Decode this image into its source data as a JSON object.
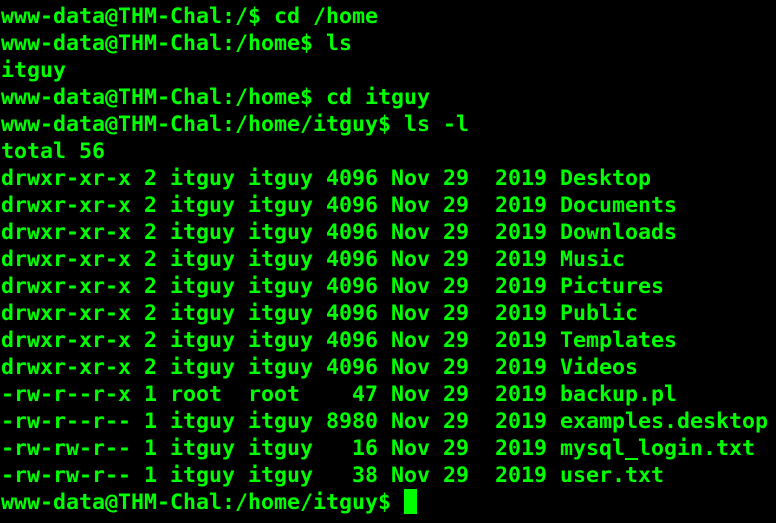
{
  "terminal": {
    "lines": [
      "www-data@THM-Chal:/$ cd /home",
      "www-data@THM-Chal:/home$ ls",
      "itguy",
      "www-data@THM-Chal:/home$ cd itguy",
      "www-data@THM-Chal:/home/itguy$ ls -l",
      "total 56",
      "drwxr-xr-x 2 itguy itguy 4096 Nov 29  2019 Desktop",
      "drwxr-xr-x 2 itguy itguy 4096 Nov 29  2019 Documents",
      "drwxr-xr-x 2 itguy itguy 4096 Nov 29  2019 Downloads",
      "drwxr-xr-x 2 itguy itguy 4096 Nov 29  2019 Music",
      "drwxr-xr-x 2 itguy itguy 4096 Nov 29  2019 Pictures",
      "drwxr-xr-x 2 itguy itguy 4096 Nov 29  2019 Public",
      "drwxr-xr-x 2 itguy itguy 4096 Nov 29  2019 Templates",
      "drwxr-xr-x 2 itguy itguy 4096 Nov 29  2019 Videos",
      "-rw-r--r-x 1 root  root    47 Nov 29  2019 backup.pl",
      "-rw-r--r-- 1 itguy itguy 8980 Nov 29  2019 examples.desktop",
      "-rw-rw-r-- 1 itguy itguy   16 Nov 29  2019 mysql_login.txt",
      "-rw-rw-r-- 1 itguy itguy   38 Nov 29  2019 user.txt"
    ],
    "prompt": "www-data@THM-Chal:/home/itguy$ ",
    "colors": {
      "background": "#000000",
      "foreground": "#00FF00"
    }
  }
}
